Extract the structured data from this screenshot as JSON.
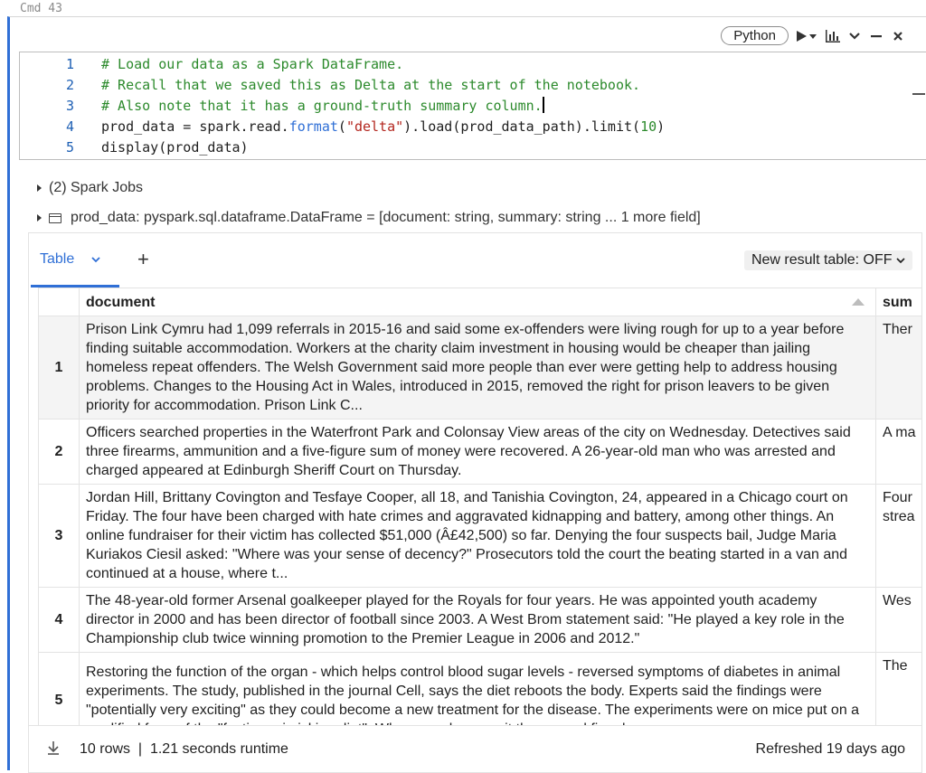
{
  "cell": {
    "command_label": "Cmd 43",
    "language": "Python"
  },
  "toolbar_icons": [
    "run-dropdown-icon",
    "chart-icon",
    "chevron-down-icon",
    "minimize-icon",
    "close-icon"
  ],
  "code_lines": [
    {
      "num": "1",
      "text": "# Load our data as a Spark DataFrame."
    },
    {
      "num": "2",
      "text": "# Recall that we saved this as Delta at the start of the notebook."
    },
    {
      "num": "3",
      "text": "# Also note that it has a ground-truth summary column."
    },
    {
      "num": "4",
      "parts": [
        "prod_data = spark.read.",
        "format",
        "(",
        "\"delta\"",
        ").load(prod_data_path).limit(",
        "10",
        ")"
      ]
    },
    {
      "num": "5",
      "parts": [
        "display",
        "(prod_data)"
      ]
    }
  ],
  "spark_jobs": "(2) Spark Jobs",
  "dataframe_info": "prod_data:  pyspark.sql.dataframe.DataFrame = [document: string, summary: string ... 1 more field]",
  "result": {
    "tab_label": "Table",
    "add_tab": "+",
    "new_result_toggle": "New result table: OFF",
    "columns": [
      "document",
      "sum"
    ],
    "rows": [
      {
        "index": "1",
        "document": "Prison Link Cymru had 1,099 referrals in 2015-16 and said some ex-offenders were living rough for up to a year before finding suitable accommodation. Workers at the charity claim investment in housing would be cheaper than jailing homeless repeat offenders. The Welsh Government said more people than ever were getting help to address housing problems. Changes to the Housing Act in Wales, introduced in 2015, removed the right for prison leavers to be given priority for accommodation. Prison Link C...",
        "summary": "Ther"
      },
      {
        "index": "2",
        "document": "Officers searched properties in the Waterfront Park and Colonsay View areas of the city on Wednesday. Detectives said three firearms, ammunition and a five-figure sum of money were recovered. A 26-year-old man who was arrested and charged appeared at Edinburgh Sheriff Court on Thursday.",
        "summary": "A ma"
      },
      {
        "index": "3",
        "document": "Jordan Hill, Brittany Covington and Tesfaye Cooper, all 18, and Tanishia Covington, 24, appeared in a Chicago court on Friday. The four have been charged with hate crimes and aggravated kidnapping and battery, among other things. An online fundraiser for their victim has collected $51,000 (Â£42,500) so far. Denying the four suspects bail, Judge Maria Kuriakos Ciesil asked: \"Where was your sense of decency?\" Prosecutors told the court the beating started in a van and continued at a house, where t...",
        "summary": "Four\nstrea"
      },
      {
        "index": "4",
        "document": "The 48-year-old former Arsenal goalkeeper played for the Royals for four years. He was appointed youth academy director in 2000 and has been director of football since 2003. A West Brom statement said: \"He played a key role in the Championship club twice winning promotion to the Premier League in 2006 and 2012.\"",
        "summary": "Wes"
      },
      {
        "index": "5",
        "document": "Restoring the function of the organ - which helps control blood sugar levels - reversed symptoms of diabetes in animal experiments. The study, published in the journal Cell, says the diet reboots the body. Experts said the findings were \"potentially very exciting\" as they could become a new treatment for the disease. The experiments were on mice put on a modified form of the \"fasting-mimicking diet\". When people go on it they spend five days",
        "summary": "The"
      }
    ],
    "footer": {
      "rows_runtime": "10 rows  |  1.21 seconds runtime",
      "refreshed": "Refreshed 19 days ago"
    }
  },
  "colors": {
    "accent": "#2f6fd6",
    "comment": "#2c8a2c",
    "string": "#b3261e"
  }
}
